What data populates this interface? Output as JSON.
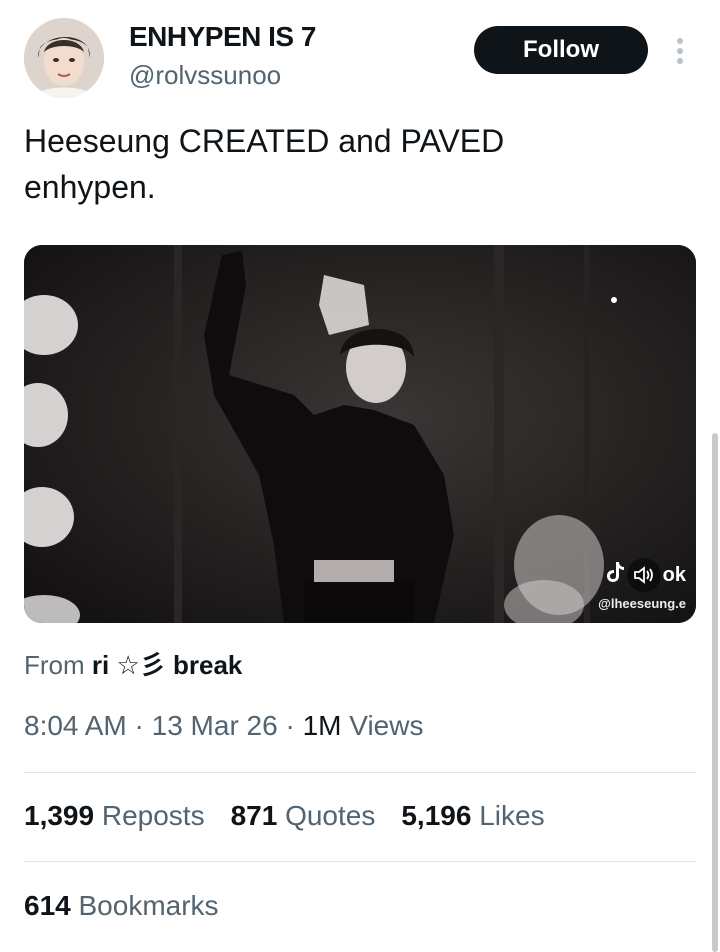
{
  "author": {
    "display_name": "ENHYPEN IS 7",
    "handle": "@rolvssunoo",
    "avatar_icon": "avatar-photo"
  },
  "follow_label": "Follow",
  "more_icon": "more-options-icon",
  "tweet": {
    "text_line1": "Heeseung CREATED and PAVED",
    "text_line2": "enhypen."
  },
  "media": {
    "watermark_brand": "TikTok",
    "watermark_user": "@lheeseung.e",
    "audio_icon": "speaker-muted-icon"
  },
  "source": {
    "prefix": "From",
    "name": "ri ☆彡 break"
  },
  "meta": {
    "time": "8:04 AM",
    "sep1": "·",
    "date": "13 Mar 26",
    "sep2": "·",
    "views_count": "1M",
    "views_label": "Views"
  },
  "stats": {
    "reposts_count": "1,399",
    "reposts_label": "Reposts",
    "quotes_count": "871",
    "quotes_label": "Quotes",
    "likes_count": "5,196",
    "likes_label": "Likes",
    "bookmarks_count": "614",
    "bookmarks_label": "Bookmarks"
  },
  "colors": {
    "text": "#0f1419",
    "secondary": "#536471",
    "follow_bg": "#0f1419",
    "divider": "#e1e6ea"
  }
}
